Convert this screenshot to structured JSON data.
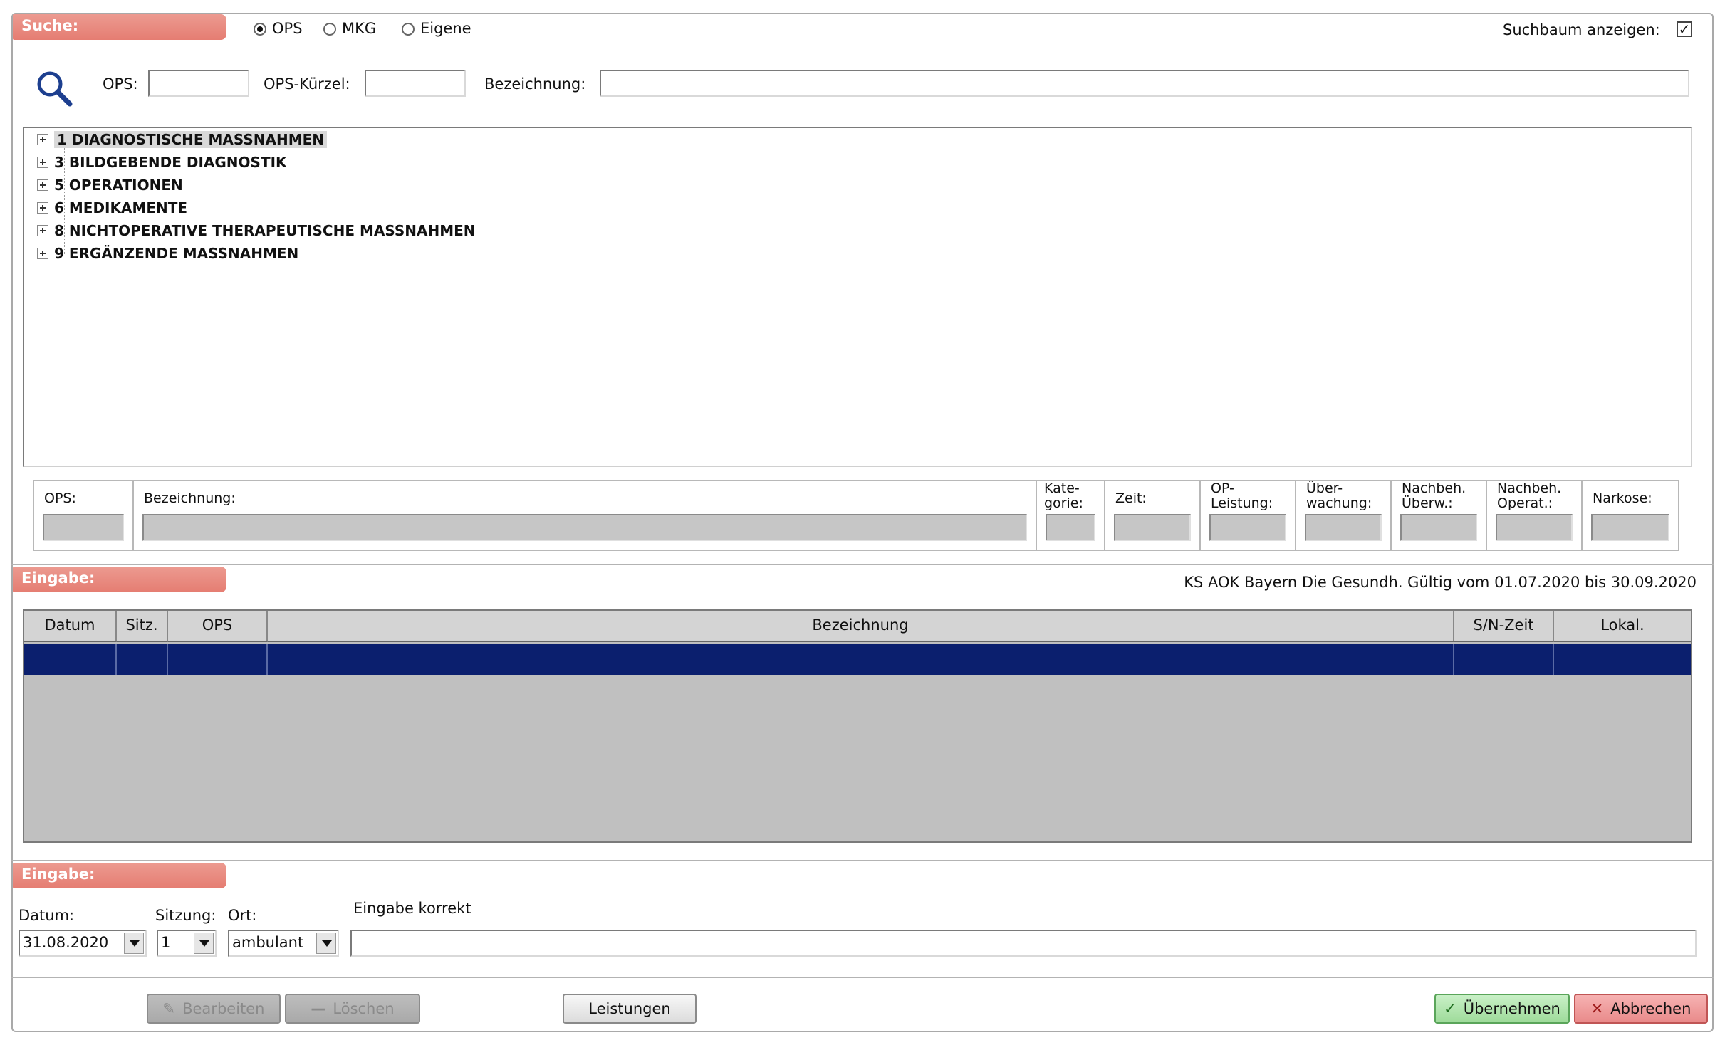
{
  "search": {
    "label": "Suche:",
    "radios": [
      {
        "label": "OPS",
        "checked": true
      },
      {
        "label": "MKG",
        "checked": false
      },
      {
        "label": "Eigene",
        "checked": false
      }
    ],
    "tree_toggle_label": "Suchbaum anzeigen:",
    "tree_toggle_checked": true,
    "tree_toggle_mark": "✓",
    "fields": {
      "ops_label": "OPS:",
      "ops_value": "",
      "kuerzel_label": "OPS-Kürzel:",
      "kuerzel_value": "",
      "bezeichnung_label": "Bezeichnung:",
      "bezeichnung_value": ""
    }
  },
  "tree": {
    "items": [
      {
        "label": "1 DIAGNOSTISCHE MASSNAHMEN"
      },
      {
        "label": "3 BILDGEBENDE DIAGNOSTIK"
      },
      {
        "label": "5 OPERATIONEN"
      },
      {
        "label": "6 MEDIKAMENTE"
      },
      {
        "label": "8 NICHTOPERATIVE THERAPEUTISCHE MASSNAHMEN"
      },
      {
        "label": "9 ERGÄNZENDE MASSNAHMEN"
      }
    ]
  },
  "details": {
    "ops": "OPS:",
    "bezeichnung": "Bezeichnung:",
    "kategorie": "Kate-\ngorie:",
    "zeit": "Zeit:",
    "op_leistung": "OP-\nLeistung:",
    "ueberwachung": "Über-\nwachung:",
    "nachbeh_ueberw": "Nachbeh.\nÜberw.:",
    "nachbeh_operat": "Nachbeh.\nOperat.:",
    "narkose": "Narkose:"
  },
  "eingabe1": {
    "label": "Eingabe:",
    "info": "KS AOK Bayern Die Gesundh. Gültig vom 01.07.2020 bis 30.09.2020"
  },
  "grid": {
    "columns": [
      "Datum",
      "Sitz.",
      "OPS",
      "Bezeichnung",
      "S/N-Zeit",
      "Lokal."
    ]
  },
  "eingabe2": {
    "label": "Eingabe:",
    "datum_label": "Datum:",
    "datum_value": "31.08.2020",
    "sitzung_label": "Sitzung:",
    "sitzung_value": "1",
    "ort_label": "Ort:",
    "ort_value": "ambulant",
    "status_label": "Eingabe korrekt",
    "status_value": ""
  },
  "buttons": {
    "bearbeiten": "Bearbeiten",
    "loeschen": "Löschen",
    "leistungen": "Leistungen",
    "uebernehmen": "Übernehmen",
    "abbrechen": "Abbrechen"
  },
  "colors": {
    "section_label": "#e57d72",
    "selected_row": "#0b1f6e",
    "grid_bg": "#c0c0c0"
  }
}
